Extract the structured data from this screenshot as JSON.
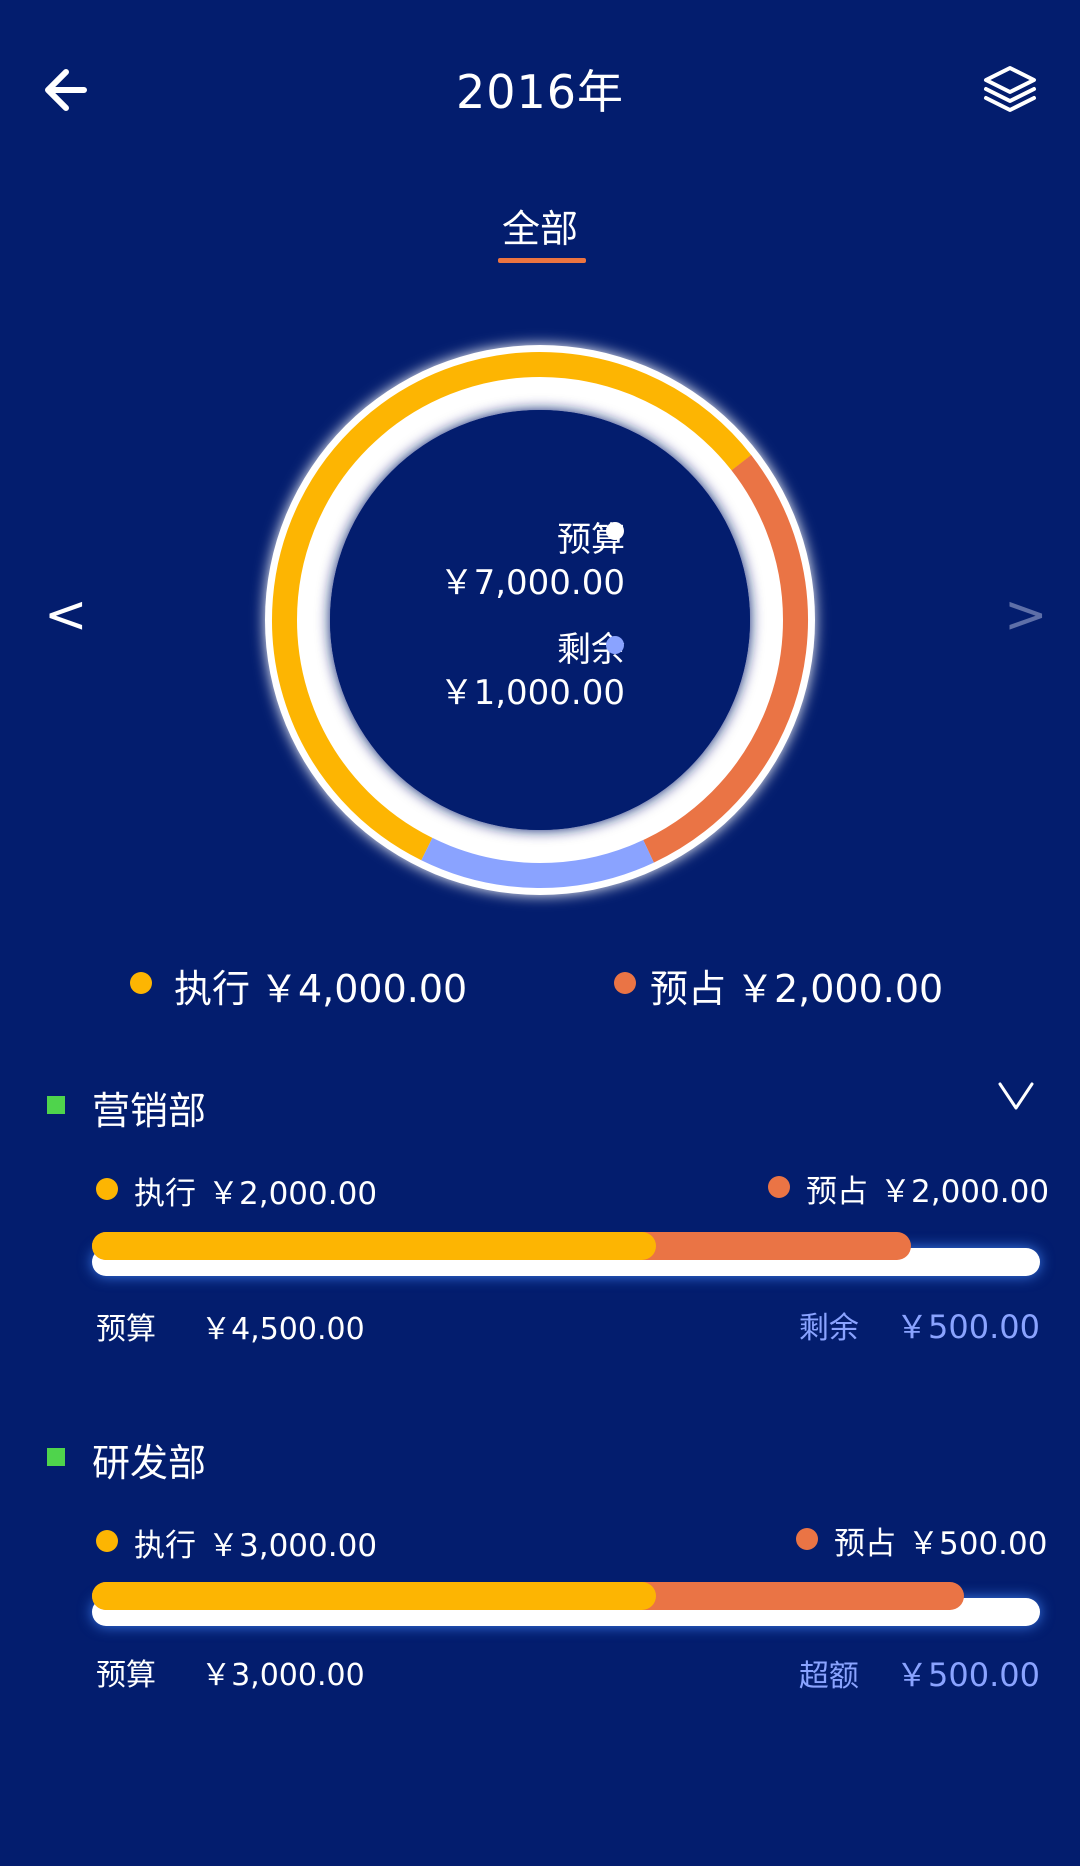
{
  "header": {
    "title": "2016年",
    "back_icon": "arrow-left-icon",
    "layers_icon": "layers-icon"
  },
  "tabs": [
    {
      "label": "全部",
      "active": true
    }
  ],
  "summary": {
    "budget_label": "预算",
    "budget_value": "￥7,000.00",
    "remaining_label": "剩余",
    "remaining_value": "￥1,000.00",
    "executed_label": "执行",
    "executed_value": "￥4,000.00",
    "reserved_label": "预占",
    "reserved_value": "￥2,000.00",
    "prev_glyph": "<",
    "next_glyph": ">"
  },
  "chart_data": {
    "type": "pie",
    "style": "donut",
    "total": 7000,
    "slices": [
      {
        "name": "执行",
        "value": 4000,
        "color": "#fdb502"
      },
      {
        "name": "预占",
        "value": 2000,
        "color": "#ea7445"
      },
      {
        "name": "剩余",
        "value": 1000,
        "color": "#8aa3ff"
      }
    ]
  },
  "departments": [
    {
      "name": "营销部",
      "executed_label": "执行",
      "executed_value": "￥2,000.00",
      "reserved_label": "预占",
      "reserved_value": "￥2,000.00",
      "budget_label": "预算",
      "budget_value": "￥4,500.00",
      "status_label": "剩余",
      "status_value": "￥500.00",
      "executed_fraction": 0.595,
      "combined_fraction": 0.864,
      "expanded_indicator": "chevron-down-icon"
    },
    {
      "name": "研发部",
      "executed_label": "执行",
      "executed_value": "￥3,000.00",
      "reserved_label": "预占",
      "reserved_value": "￥500.00",
      "budget_label": "预算",
      "budget_value": "￥3,000.00",
      "status_label": "超额",
      "status_value": "￥500.00",
      "executed_fraction": 0.595,
      "combined_fraction": 0.92
    }
  ],
  "colors": {
    "background": "#031d6e",
    "executed": "#fdb502",
    "reserved": "#ea7445",
    "remaining": "#8aa3ff",
    "tab_accent": "#ec7440",
    "dept_marker": "#4fd44c"
  }
}
